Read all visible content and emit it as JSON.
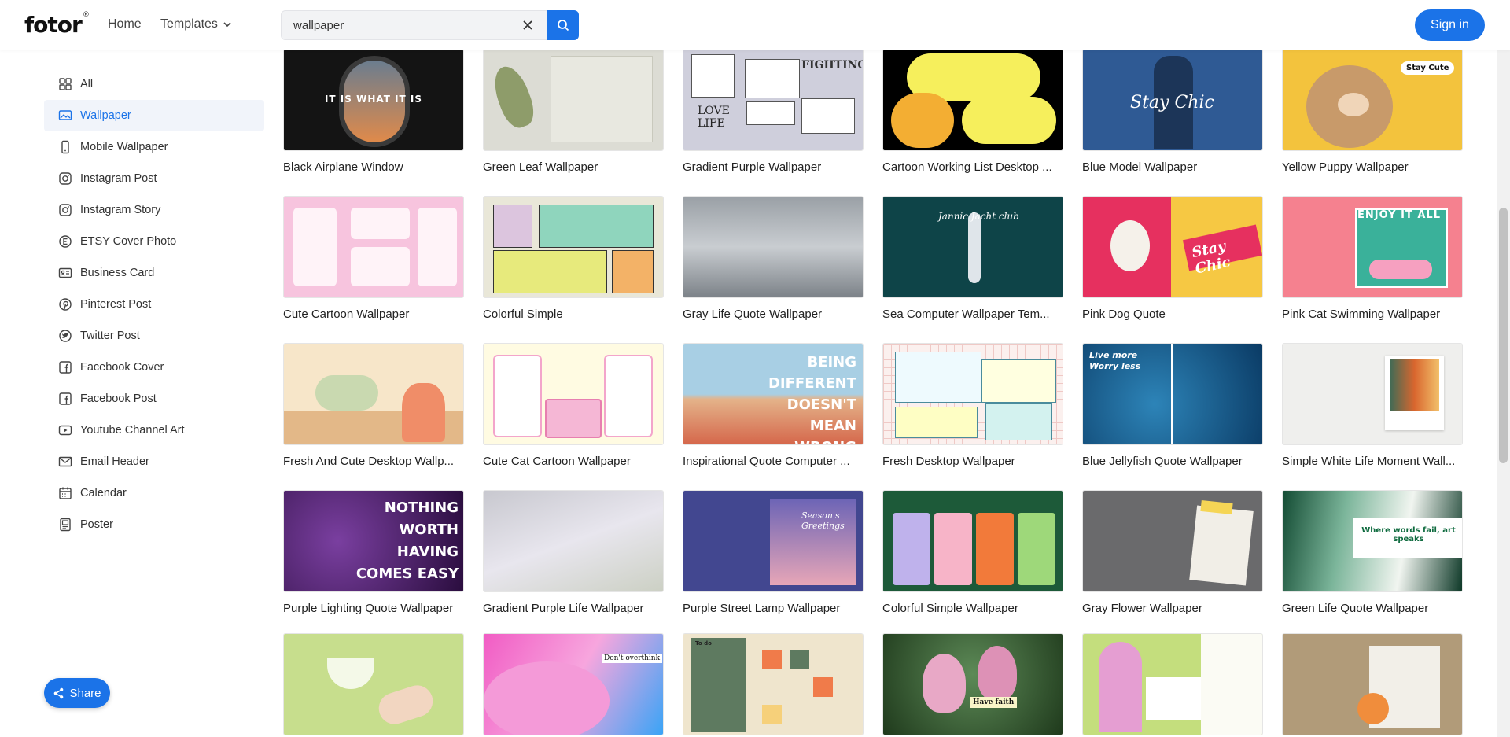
{
  "header": {
    "logo": "fotor",
    "logo_mark": "®",
    "nav_home": "Home",
    "nav_templates": "Templates",
    "search_value": "wallpaper",
    "sign_in": "Sign in"
  },
  "sidebar": {
    "items": [
      {
        "label": "All",
        "icon": "grid-icon"
      },
      {
        "label": "Wallpaper",
        "icon": "wallpaper-icon",
        "active": true
      },
      {
        "label": "Mobile Wallpaper",
        "icon": "phone-icon"
      },
      {
        "label": "Instagram Post",
        "icon": "instagram-icon"
      },
      {
        "label": "Instagram Story",
        "icon": "instagram-icon"
      },
      {
        "label": "ETSY Cover Photo",
        "icon": "etsy-icon"
      },
      {
        "label": "Business Card",
        "icon": "card-icon"
      },
      {
        "label": "Pinterest Post",
        "icon": "pinterest-icon"
      },
      {
        "label": "Twitter Post",
        "icon": "twitter-icon"
      },
      {
        "label": "Facebook Cover",
        "icon": "facebook-icon"
      },
      {
        "label": "Facebook Post",
        "icon": "facebook-icon"
      },
      {
        "label": "Youtube Channel Art",
        "icon": "youtube-icon"
      },
      {
        "label": "Email Header",
        "icon": "mail-icon"
      },
      {
        "label": "Calendar",
        "icon": "calendar-icon"
      },
      {
        "label": "Poster",
        "icon": "poster-icon"
      }
    ]
  },
  "templates": [
    {
      "title": "Black Airplane Window",
      "overlay": "IT IS WHAT IT IS"
    },
    {
      "title": "Green Leaf Wallpaper"
    },
    {
      "title": "Gradient Purple Wallpaper",
      "overlay": "FIGHTING",
      "overlay2": "LOVE LIFE"
    },
    {
      "title": "Cartoon Working List Desktop ..."
    },
    {
      "title": "Blue Model Wallpaper",
      "overlay": "Stay Chic"
    },
    {
      "title": "Yellow Puppy Wallpaper",
      "overlay": "Stay Cute"
    },
    {
      "title": "Cute Cartoon Wallpaper"
    },
    {
      "title": "Colorful Simple"
    },
    {
      "title": "Gray Life Quote Wallpaper"
    },
    {
      "title": "Sea Computer Wallpaper Tem...",
      "overlay": "Jannic Jacht club"
    },
    {
      "title": "Pink Dog Quote",
      "overlay": "Stay Chic"
    },
    {
      "title": "Pink Cat Swimming Wallpaper",
      "overlay": "ENJOY IT ALL"
    },
    {
      "title": "Fresh And Cute Desktop Wallp..."
    },
    {
      "title": "Cute Cat Cartoon Wallpaper"
    },
    {
      "title": "Inspirational Quote Computer ...",
      "overlay": "BEING DIFFERENT DOESN'T MEAN WRONG"
    },
    {
      "title": "Fresh Desktop Wallpaper"
    },
    {
      "title": "Blue Jellyfish Quote Wallpaper",
      "overlay": "Live more Worry less"
    },
    {
      "title": "Simple White Life Moment Wall..."
    },
    {
      "title": "Purple Lighting Quote Wallpaper",
      "overlay": "NOTHING WORTH HAVING COMES EASY"
    },
    {
      "title": "Gradient Purple Life Wallpaper"
    },
    {
      "title": "Purple Street Lamp Wallpaper",
      "overlay": "Season's Greetings"
    },
    {
      "title": "Colorful Simple Wallpaper"
    },
    {
      "title": "Gray Flower Wallpaper"
    },
    {
      "title": "Green Life Quote Wallpaper",
      "overlay": "Where words fail, art speaks"
    },
    {
      "title": "",
      "overlay": ""
    },
    {
      "title": "",
      "overlay": "Don't overthink"
    },
    {
      "title": "",
      "overlay": "To do"
    },
    {
      "title": "",
      "overlay": "Have faith"
    },
    {
      "title": "",
      "overlay": ""
    },
    {
      "title": "",
      "overlay": ""
    }
  ],
  "share": {
    "label": "Share"
  },
  "colors": {
    "accent": "#1b73e8"
  }
}
